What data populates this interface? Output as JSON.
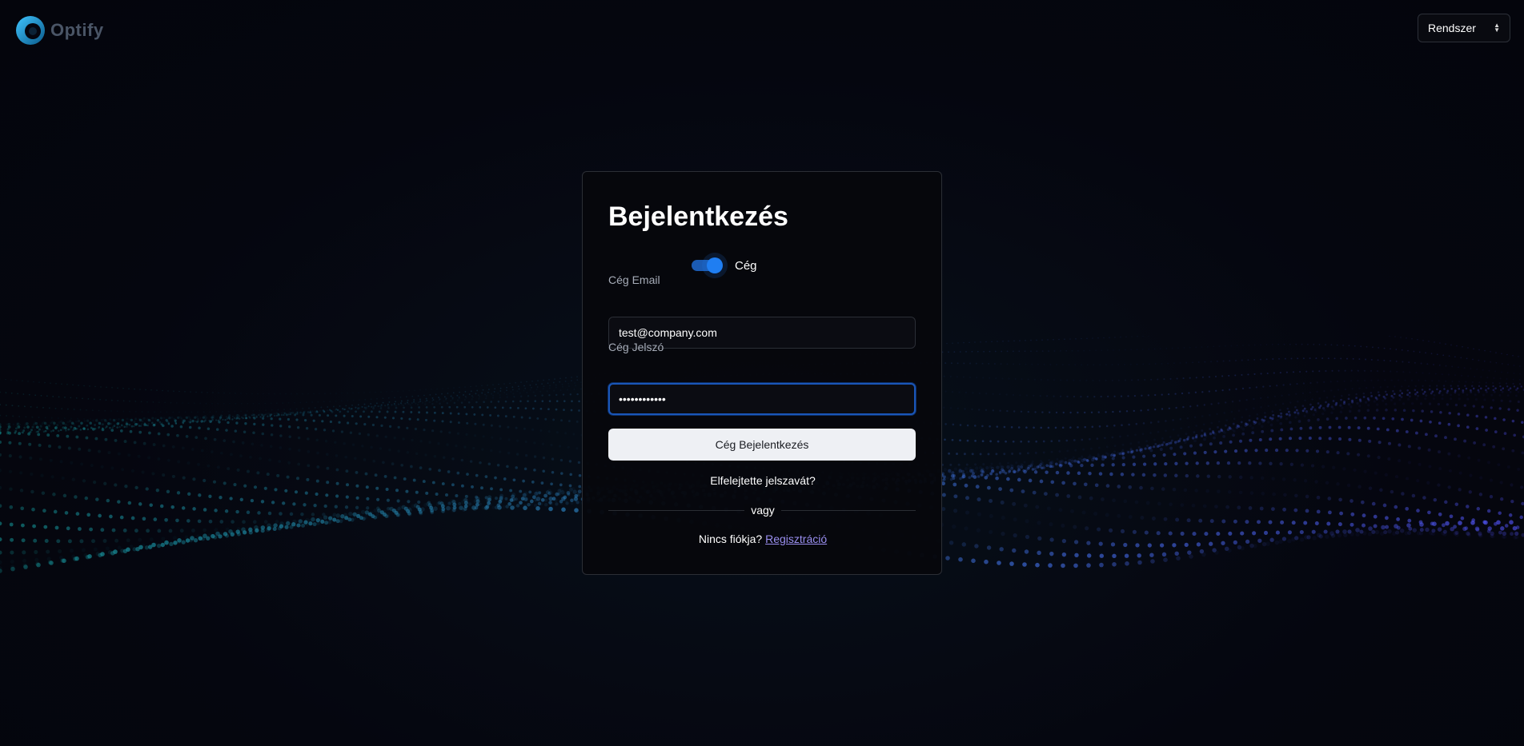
{
  "header": {
    "logo_text": "Optify",
    "theme_select": {
      "value": "Rendszer",
      "icon": "chevron-up-down-icon"
    }
  },
  "login": {
    "title": "Bejelentkezés",
    "account_toggle": {
      "label": "Cég",
      "on": true
    },
    "email": {
      "label": "Cég Email",
      "value": "test@company.com"
    },
    "password": {
      "label": "Cég Jelszó",
      "value": "••••••••••••"
    },
    "submit_label": "Cég Bejelentkezés",
    "forgot_label": "Elfelejtette jelszavát?",
    "divider_text": "vagy",
    "register": {
      "prompt": "Nincs fiókja?",
      "link_label": "Regisztráció"
    }
  },
  "colors": {
    "background": "#05060f",
    "accent": "#1f7ef2",
    "wave_dots": "#1aa3a3",
    "link": "#9a8ff0"
  }
}
